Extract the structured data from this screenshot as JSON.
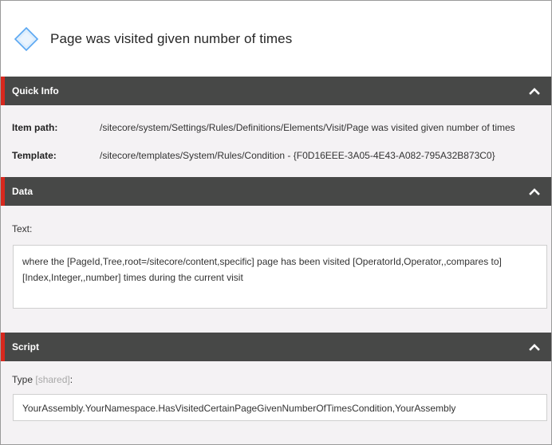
{
  "title": {
    "text": "Page was visited given number of times",
    "icon": "condition-diamond-icon",
    "icon_color": "#5aa7f2"
  },
  "quick_info": {
    "header": "Quick Info",
    "item_path_label": "Item path:",
    "item_path_value": "/sitecore/system/Settings/Rules/Definitions/Elements/Visit/Page was visited given number of times",
    "template_label": "Template:",
    "template_value": "/sitecore/templates/System/Rules/Condition - {F0D16EEE-3A05-4E43-A082-795A32B873C0}"
  },
  "data": {
    "header": "Data",
    "text_label": "Text:",
    "text_value": "where the [PageId,Tree,root=/sitecore/content,specific] page has been visited [OperatorId,Operator,,compares to] [Index,Integer,,number] times during the current visit"
  },
  "script": {
    "header": "Script",
    "type_label": "Type",
    "type_shared": "[shared]",
    "type_suffix": ":",
    "type_value": "YourAssembly.YourNamespace.HasVisitedCertainPageGivenNumberOfTimesCondition,YourAssembly"
  },
  "colors": {
    "header_bg": "#474847",
    "accent": "#d7281e",
    "body_bg": "#f4f2f4"
  }
}
